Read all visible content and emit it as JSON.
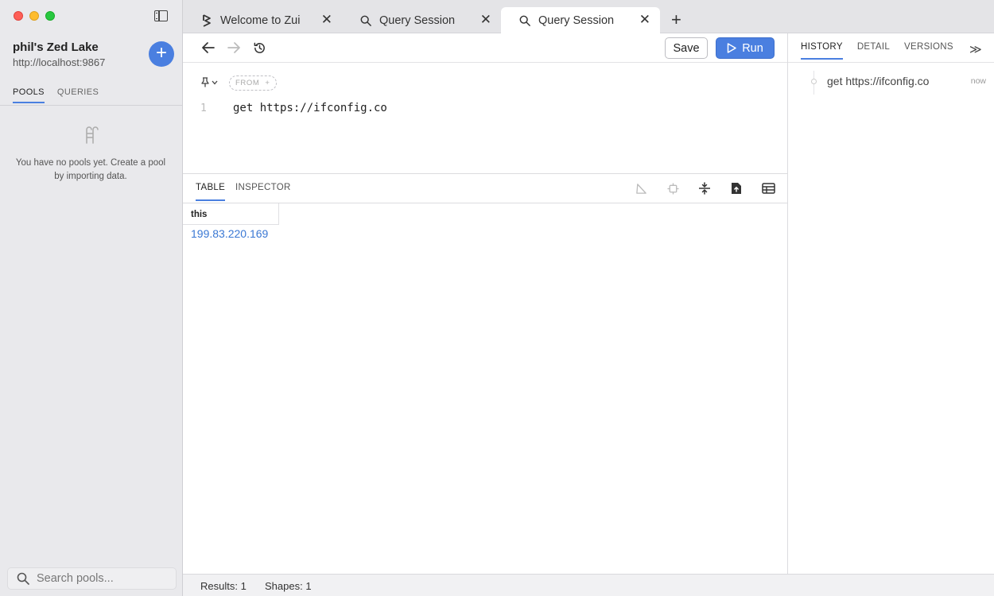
{
  "sidebar": {
    "lake_name": "phil's Zed Lake",
    "lake_url": "http://localhost:9867",
    "add_label": "+",
    "tabs": [
      {
        "label": "POOLS",
        "active": true
      },
      {
        "label": "QUERIES",
        "active": false
      }
    ],
    "empty_message": "You have no pools yet. Create a pool by importing data.",
    "search_placeholder": "Search pools..."
  },
  "tabs": [
    {
      "label": "Welcome to Zui",
      "icon": "zui-logo-icon",
      "active": false
    },
    {
      "label": "Query Session",
      "icon": "search-icon",
      "active": false
    },
    {
      "label": "Query Session",
      "icon": "search-icon",
      "active": true
    }
  ],
  "tab_close_glyph": "✕",
  "new_tab_glyph": "+",
  "toolbar": {
    "save_label": "Save",
    "run_label": "Run"
  },
  "editor": {
    "from_label": "FROM",
    "from_add": "+",
    "line_number": "1",
    "code": "get https://ifconfig.co"
  },
  "results": {
    "tabs": [
      {
        "label": "TABLE",
        "active": true
      },
      {
        "label": "INSPECTOR",
        "active": false
      }
    ],
    "column": "this",
    "value": "199.83.220.169"
  },
  "right_panel": {
    "tabs": [
      {
        "label": "HISTORY",
        "active": true
      },
      {
        "label": "DETAIL",
        "active": false
      },
      {
        "label": "VERSIONS",
        "active": false
      }
    ],
    "expand_glyph": "≫",
    "history": [
      {
        "query": "get https://ifconfig.co",
        "time": "now"
      }
    ]
  },
  "status": {
    "results": "Results: 1",
    "shapes": "Shapes: 1"
  },
  "colors": {
    "accent": "#4a7fe0",
    "link": "#3a78d4"
  }
}
